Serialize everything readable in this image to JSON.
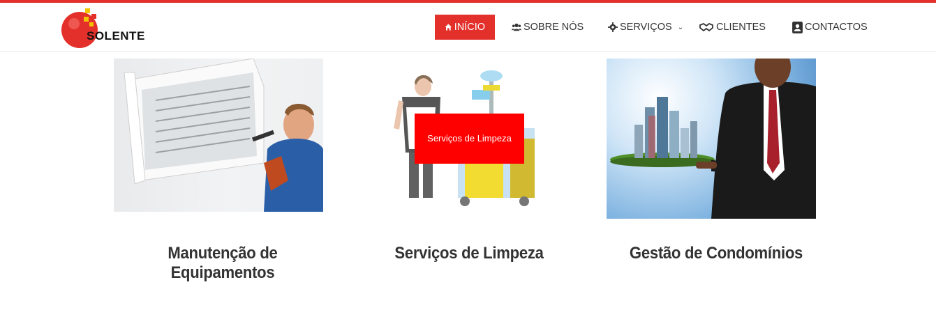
{
  "brand": {
    "name": "SOLENTE",
    "accent": "#e3302a"
  },
  "nav": {
    "items": [
      {
        "label": "INÍCIO",
        "icon": "home-icon"
      },
      {
        "label": "SOBRE NÓS",
        "icon": "users-icon"
      },
      {
        "label": "SERVIÇOS",
        "icon": "gear-icon"
      },
      {
        "label": "CLIENTES",
        "icon": "handshake-icon"
      },
      {
        "label": "CONTACTOS",
        "icon": "contact-card-icon"
      }
    ]
  },
  "services": [
    {
      "title": "Manutenção de Equipamentos"
    },
    {
      "title": "Serviços de Limpeza",
      "overlay": "Serviços de Limpeza"
    },
    {
      "title": "Gestão de Condomínios"
    }
  ]
}
